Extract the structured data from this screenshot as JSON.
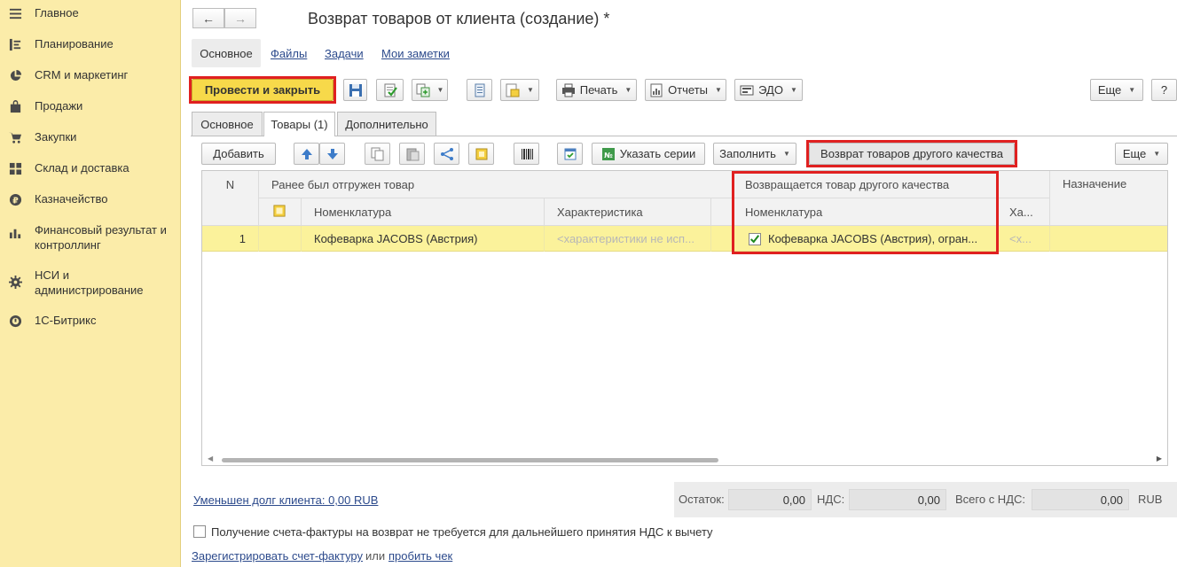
{
  "sidebar": {
    "items": [
      {
        "label": "Главное",
        "icon": "menu-icon"
      },
      {
        "label": "Планирование",
        "icon": "planning-icon"
      },
      {
        "label": "CRM и маркетинг",
        "icon": "pie-chart-icon"
      },
      {
        "label": "Продажи",
        "icon": "bag-icon"
      },
      {
        "label": "Закупки",
        "icon": "cart-icon"
      },
      {
        "label": "Склад и доставка",
        "icon": "warehouse-icon"
      },
      {
        "label": "Казначейство",
        "icon": "ruble-coin-icon"
      },
      {
        "label": "Финансовый результат и контроллинг",
        "icon": "bar-chart-icon"
      },
      {
        "label": "НСИ и администрирование",
        "icon": "gear-icon"
      },
      {
        "label": "1С-Битрикс",
        "icon": "bitrix-icon"
      }
    ]
  },
  "header": {
    "title": "Возврат товаров от клиента (создание) *",
    "back": "←",
    "forward": "→"
  },
  "form_tabs": {
    "active": "Основное",
    "links": [
      "Файлы",
      "Задачи",
      "Мои заметки"
    ]
  },
  "toolbar": {
    "post_close": "Провести и закрыть",
    "print": "Печать",
    "reports": "Отчеты",
    "edo": "ЭДО",
    "more": "Еще",
    "help": "?"
  },
  "tabs": [
    "Основное",
    "Товары (1)",
    "Дополнительно"
  ],
  "table_toolbar": {
    "add": "Добавить",
    "specify_series": "Указать серии",
    "fill": "Заполнить",
    "return_other_quality": "Возврат товаров другого качества",
    "more": "Еще"
  },
  "table": {
    "group_headers": {
      "n": "N",
      "shipped": "Ранее был отгружен товар",
      "returned": "Возвращается товар другого качества",
      "purpose": "Назначение"
    },
    "columns": {
      "nomenclature": "Номенклатура",
      "characteristic": "Характеристика",
      "ret_nomenclature": "Номенклатура",
      "ret_char": "Ха..."
    },
    "rows": [
      {
        "n": "1",
        "nomenclature": "Кофеварка JACOBS (Австрия)",
        "characteristic": "<характеристики не исп...",
        "ret_nomenclature": "Кофеварка JACOBS (Австрия), огран...",
        "ret_char": "<х...",
        "checked": true
      }
    ]
  },
  "footer": {
    "debt_link": "Уменьшен долг клиента: 0,00 RUB",
    "remainder_label": "Остаток:",
    "remainder_value": "0,00",
    "vat_label": "НДС:",
    "vat_value": "0,00",
    "total_label": "Всего с НДС:",
    "total_value": "0,00",
    "currency": "RUB",
    "invoice_checkbox_label": "Получение счета-фактуры на возврат не требуется для дальнейшего принятия НДС к вычету",
    "register_invoice": "Зарегистрировать счет-фактуру",
    "or": "или",
    "punch_check": "пробить чек"
  },
  "colors": {
    "sidebar_bg": "#fbeca9",
    "primary_button": "#f7d94a",
    "selected_row": "#fbf29b",
    "highlight_frame": "#e02020",
    "link": "#2c4a8c"
  }
}
